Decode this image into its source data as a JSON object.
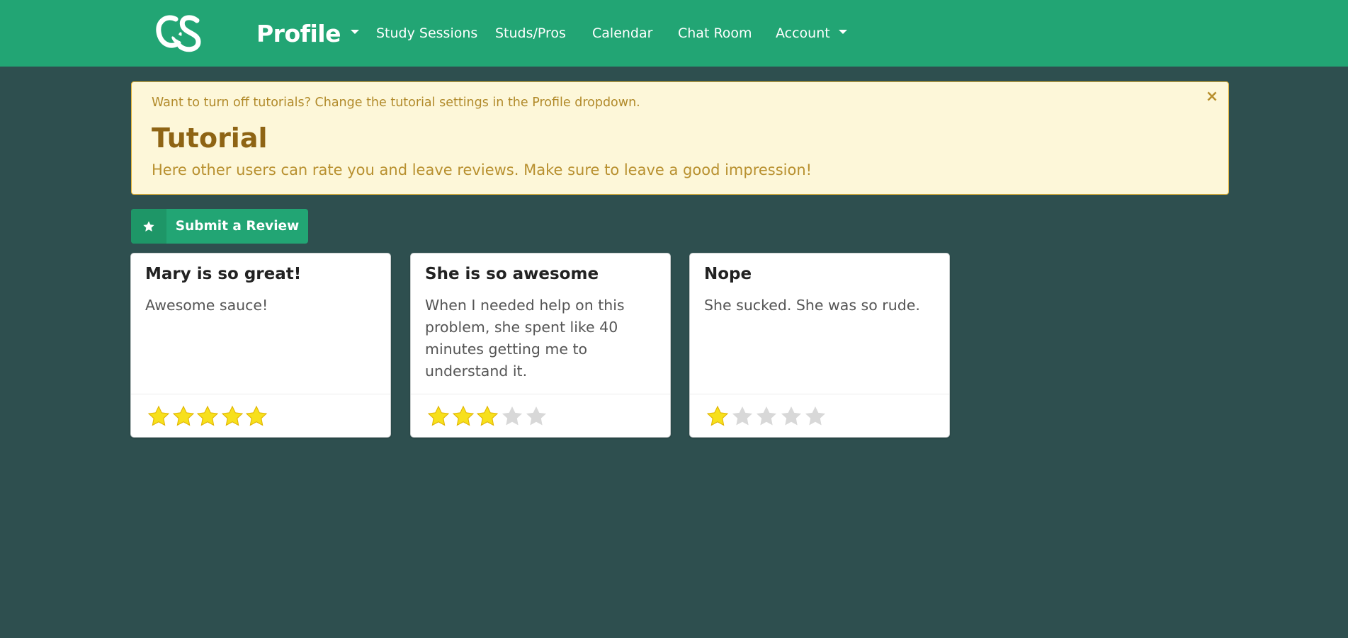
{
  "navbar": {
    "brand_label": "Profile",
    "links": [
      {
        "label": "Study Sessions"
      },
      {
        "label": "Studs/Pros"
      },
      {
        "label": "Calendar"
      },
      {
        "label": "Chat Room"
      },
      {
        "label": "Account"
      }
    ],
    "logo_text": "CS"
  },
  "alert": {
    "note": "Want to turn off tutorials? Change the tutorial settings in the Profile dropdown.",
    "title": "Tutorial",
    "body": "Here other users can rate you and leave reviews. Make sure to leave a good impression!",
    "close_glyph": "×"
  },
  "review_button": {
    "label": "Submit a Review",
    "icon": "star-icon"
  },
  "reviews": [
    {
      "title": "Mary is so great!",
      "text": "Awesome sauce!",
      "rating": 5,
      "max_rating": 5
    },
    {
      "title": "She is so awesome",
      "text": "When I needed help on this problem, she spent like 40 minutes getting me to understand it.",
      "rating": 3,
      "max_rating": 5
    },
    {
      "title": "Nope",
      "text": "She sucked. She was so rude.",
      "rating": 1,
      "max_rating": 5
    }
  ],
  "colors": {
    "navbar": "#22a574",
    "background": "#2e4f4f",
    "star_filled": "#f7e01c",
    "star_empty": "#d8d8d8",
    "alert_background": "#fdf7d9"
  }
}
